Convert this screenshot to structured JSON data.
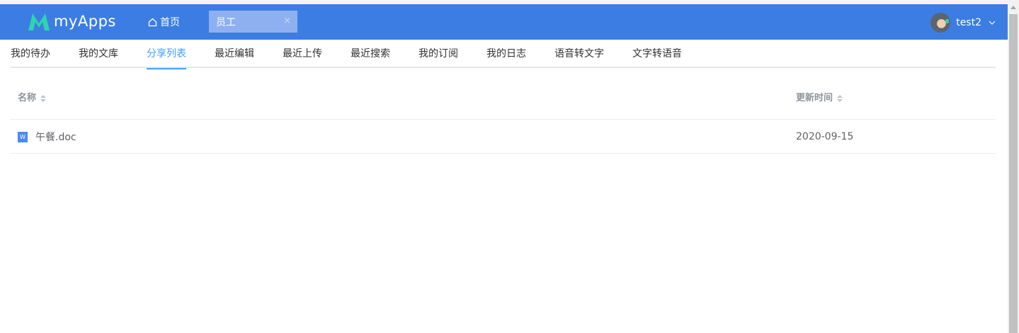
{
  "header": {
    "app_name": "myApps",
    "home_label": "首页",
    "open_tab": {
      "label": "员工",
      "close": "×"
    },
    "user_name": "test2",
    "brand_color": "#3c7de4"
  },
  "nav": {
    "items": [
      {
        "label": "我的待办"
      },
      {
        "label": "我的文库"
      },
      {
        "label": "分享列表"
      },
      {
        "label": "最近编辑"
      },
      {
        "label": "最近上传"
      },
      {
        "label": "最近搜索"
      },
      {
        "label": "我的订阅"
      },
      {
        "label": "我的日志"
      },
      {
        "label": "语音转文字"
      },
      {
        "label": "文字转语音"
      }
    ],
    "active": "分享列表",
    "active_color": "#409eff"
  },
  "table": {
    "columns": [
      {
        "label": "名称"
      },
      {
        "label": "更新时间"
      }
    ],
    "rows": [
      {
        "icon": "word-doc-icon",
        "icon_letter": "W",
        "name": "午餐.doc",
        "updated": "2020-09-15"
      }
    ]
  }
}
